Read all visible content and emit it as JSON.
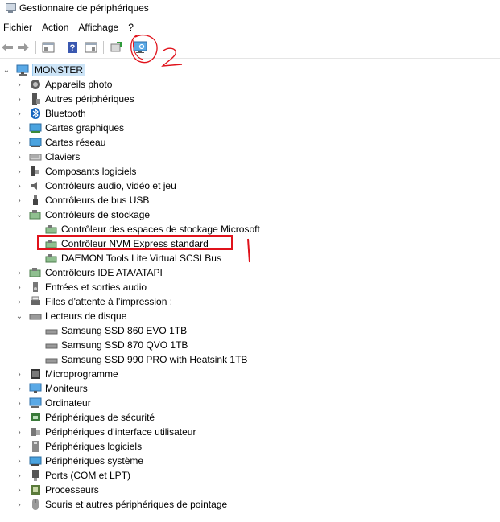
{
  "window": {
    "title": "Gestionnaire de périphériques"
  },
  "menu": [
    "Fichier",
    "Action",
    "Affichage",
    "?"
  ],
  "toolbar": {
    "buttons": [
      "back-icon",
      "forward-icon",
      "properties-icon",
      "help-icon",
      "show-hide-icon",
      "update-driver-icon",
      "scan-hardware-icon"
    ],
    "annotation_text": "2"
  },
  "tree": {
    "root": "MONSTER",
    "items": [
      {
        "label": "Appareils photo",
        "icon": "camera-icon"
      },
      {
        "label": "Autres périphériques",
        "icon": "unknown-device-icon"
      },
      {
        "label": "Bluetooth",
        "icon": "bluetooth-icon"
      },
      {
        "label": "Cartes graphiques",
        "icon": "display-adapter-icon"
      },
      {
        "label": "Cartes réseau",
        "icon": "network-adapter-icon"
      },
      {
        "label": "Claviers",
        "icon": "keyboard-icon"
      },
      {
        "label": "Composants logiciels",
        "icon": "software-component-icon"
      },
      {
        "label": "Contrôleurs audio, vidéo et jeu",
        "icon": "audio-icon"
      },
      {
        "label": "Contrôleurs de bus USB",
        "icon": "usb-icon"
      },
      {
        "label": "Contrôleurs de stockage",
        "icon": "storage-controller-icon",
        "expanded": true,
        "children": [
          "Contrôleur des espaces de stockage Microsoft",
          "Contrôleur NVM Express standard",
          "DAEMON Tools Lite Virtual SCSI Bus"
        ]
      },
      {
        "label": "Contrôleurs IDE ATA/ATAPI",
        "icon": "ide-controller-icon"
      },
      {
        "label": "Entrées et sorties audio",
        "icon": "speaker-icon"
      },
      {
        "label": "Files d’attente à l’impression :",
        "icon": "printer-icon"
      },
      {
        "label": "Lecteurs de disque",
        "icon": "disk-drive-icon",
        "expanded": true,
        "children": [
          "Samsung SSD 860 EVO 1TB",
          "Samsung SSD 870 QVO 1TB",
          "Samsung SSD 990 PRO with Heatsink 1TB"
        ]
      },
      {
        "label": "Microprogramme",
        "icon": "firmware-icon"
      },
      {
        "label": "Moniteurs",
        "icon": "monitor-icon"
      },
      {
        "label": "Ordinateur",
        "icon": "computer-icon"
      },
      {
        "label": "Périphériques de sécurité",
        "icon": "security-device-icon"
      },
      {
        "label": "Périphériques d’interface utilisateur",
        "icon": "hid-icon"
      },
      {
        "label": "Périphériques logiciels",
        "icon": "software-device-icon"
      },
      {
        "label": "Périphériques système",
        "icon": "system-device-icon"
      },
      {
        "label": "Ports (COM et LPT)",
        "icon": "port-icon"
      },
      {
        "label": "Processeurs",
        "icon": "processor-icon"
      },
      {
        "label": "Souris et autres périphériques de pointage",
        "icon": "mouse-icon"
      }
    ]
  },
  "colors": {
    "annotation": "#e0121b",
    "selection": "#cce4f7"
  }
}
